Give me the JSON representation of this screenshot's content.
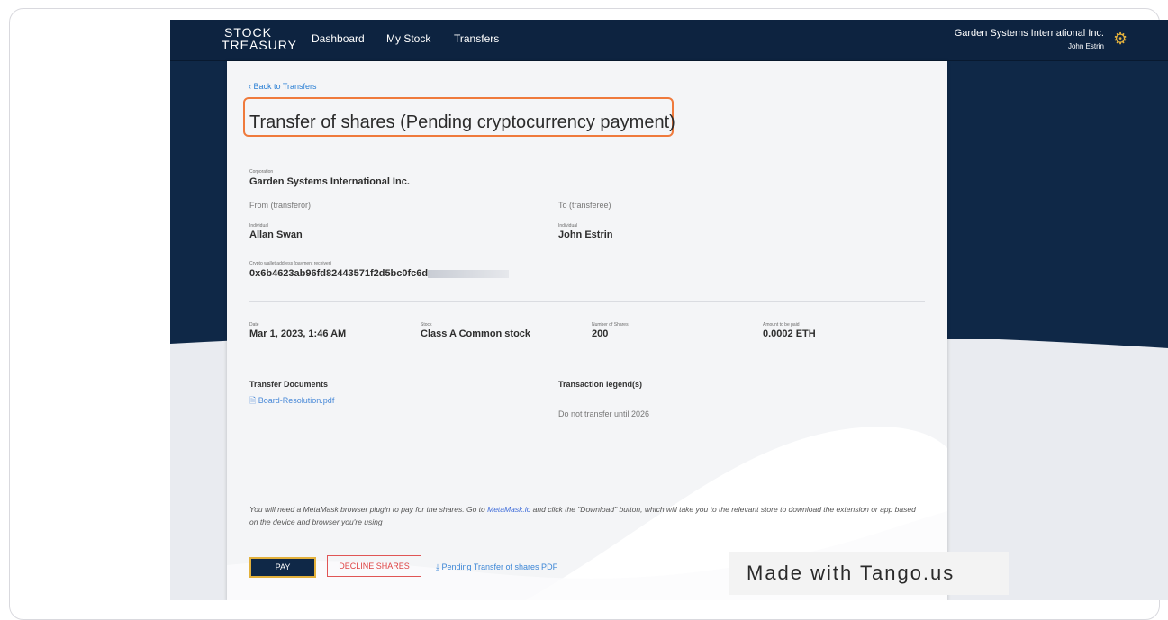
{
  "header": {
    "logo_top": "STOCK",
    "logo_bottom": "TREASURY",
    "nav": [
      "Dashboard",
      "My Stock",
      "Transfers"
    ],
    "corporation": "Garden Systems International Inc.",
    "user": "John Estrin",
    "settings_icon": "gear-icon",
    "brand_color": "#0f2847",
    "accent_color": "#e3b13c"
  },
  "page": {
    "back_link": "‹  Back to Transfers",
    "title": "Transfer of shares (Pending cryptocurrency payment)",
    "corporation_label": "Corporation",
    "corporation_value": "Garden Systems International Inc.",
    "from_heading": "From (transferor)",
    "to_heading": "To (transferee)",
    "from_type": "Individual",
    "from_name": "Allan Swan",
    "to_type": "Individual",
    "to_name": "John Estrin",
    "wallet_label": "Crypto wallet address (payment receiver)",
    "wallet_value": "0x6b4623ab96fd82443571f2d5bc0fc6d",
    "date_label": "Date",
    "date_value": "Mar 1, 2023, 1:46 AM",
    "stock_label": "Stock",
    "stock_value": "Class A Common stock",
    "shares_label": "Number of Shares",
    "shares_value": "200",
    "amount_label": "Amount to be paid",
    "amount_value": "0.0002 ETH",
    "docs_heading": "Transfer Documents",
    "doc_file": "Board-Resolution.pdf",
    "legend_heading": "Transaction legend(s)",
    "legend_text": "Do not transfer until 2026",
    "notice_before": "You will need a MetaMask browser plugin to pay for the shares. Go to ",
    "notice_link": "MetaMask.io",
    "notice_after": " and click the \"Download\" button, which will take you to the relevant store to download the extension or app based on the device and browser you're using",
    "pay_button": "PAY",
    "decline_button": "DECLINE SHARES",
    "pdf_link": "Pending Transfer of shares PDF"
  },
  "watermark": "Made with Tango.us"
}
